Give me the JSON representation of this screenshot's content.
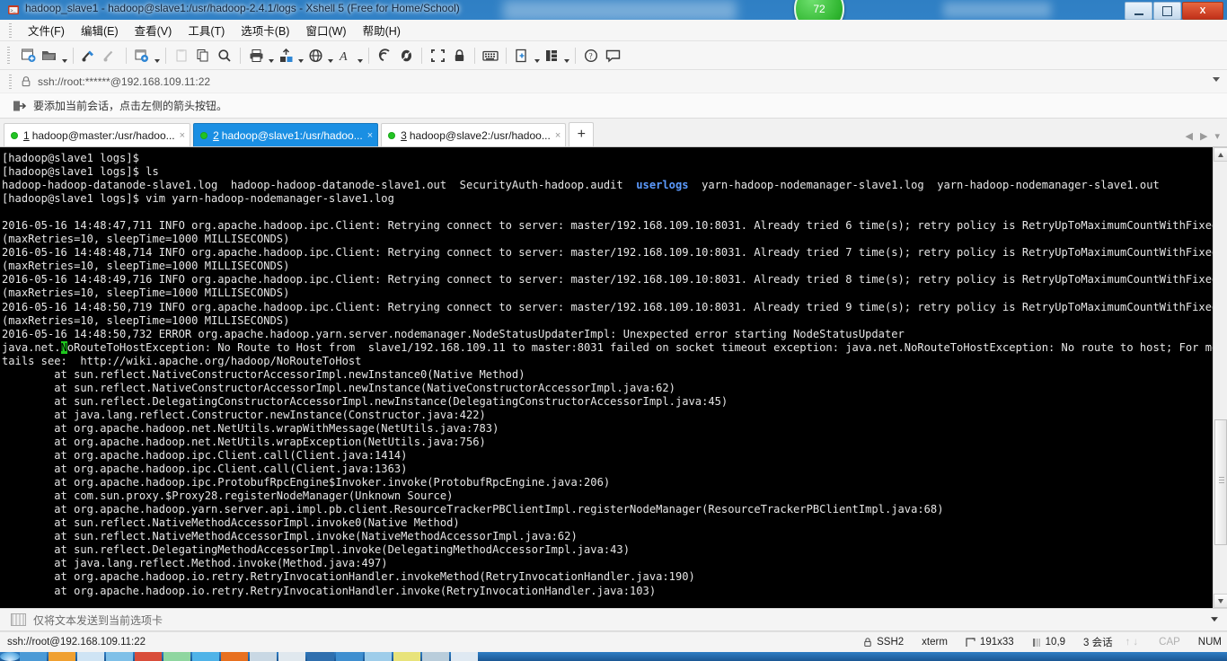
{
  "window": {
    "title": "hadoop_slave1 - hadoop@slave1:/usr/hadoop-2.4.1/logs - Xshell 5 (Free for Home/School)",
    "minimize_label": "Minimize",
    "maximize_label": "Maximize",
    "close_label": "X"
  },
  "desktop": {
    "gadget_value": "72"
  },
  "menubar": {
    "items": [
      {
        "label": "文件(F)",
        "name": "menu-file"
      },
      {
        "label": "编辑(E)",
        "name": "menu-edit"
      },
      {
        "label": "查看(V)",
        "name": "menu-view"
      },
      {
        "label": "工具(T)",
        "name": "menu-tools"
      },
      {
        "label": "选项卡(B)",
        "name": "menu-tabs"
      },
      {
        "label": "窗口(W)",
        "name": "menu-window"
      },
      {
        "label": "帮助(H)",
        "name": "menu-help"
      }
    ]
  },
  "toolbar": {
    "icons": [
      "new-session-icon",
      "open-folder-icon",
      "caret-open",
      "sep",
      "connect-icon",
      "disconnect-icon",
      "sep",
      "session-properties-icon",
      "caret-props",
      "sep",
      "paste-disabled-icon",
      "copy-icon",
      "find-icon",
      "sep",
      "print-icon",
      "caret-print",
      "transfer-icon",
      "caret-transfer",
      "browser-icon",
      "caret-browser",
      "font-icon",
      "caret-font",
      "sep",
      "ssh-tunnel-icon",
      "tunnel-pane-icon",
      "sep",
      "fullscreen-icon",
      "lock-icon",
      "sep",
      "keyboard-icon",
      "sep",
      "compose-pane-icon",
      "caret-compose",
      "layout-icon",
      "caret-layout",
      "sep",
      "help-icon",
      "feedback-icon"
    ]
  },
  "address_bar": {
    "icon": "lock-icon",
    "value": "ssh://root:******@192.168.109.11:22",
    "dropdown_icon": "chevron-down-icon"
  },
  "hint_bar": {
    "icon": "add-session-icon",
    "text": "要添加当前会话，点击左侧的箭头按钮。"
  },
  "tabs": {
    "items": [
      {
        "num": "1",
        "label": "hadoop@master:/usr/hadoo...",
        "active": false,
        "status": "connected",
        "close": "×"
      },
      {
        "num": "2",
        "label": "hadoop@slave1:/usr/hadoo...",
        "active": true,
        "status": "connected",
        "close": "×"
      },
      {
        "num": "3",
        "label": "hadoop@slave2:/usr/hadoo...",
        "active": false,
        "status": "connected",
        "close": "×"
      }
    ],
    "add_label": "+",
    "nav_prev": "◀",
    "nav_next": "▶",
    "nav_menu": "▾"
  },
  "terminal": {
    "lines": [
      {
        "segments": [
          {
            "t": "[hadoop@slave1 logs]$ "
          }
        ]
      },
      {
        "segments": [
          {
            "t": "[hadoop@slave1 logs]$ ls"
          }
        ]
      },
      {
        "segments": [
          {
            "t": "hadoop-hadoop-datanode-slave1.log  hadoop-hadoop-datanode-slave1.out  SecurityAuth-hadoop.audit  "
          },
          {
            "t": "userlogs",
            "c": "blue"
          },
          {
            "t": "  yarn-hadoop-nodemanager-slave1.log  yarn-hadoop-nodemanager-slave1.out"
          }
        ]
      },
      {
        "segments": [
          {
            "t": "[hadoop@slave1 logs]$ vim yarn-hadoop-nodemanager-slave1.log"
          }
        ]
      },
      {
        "segments": [
          {
            "t": ""
          }
        ]
      },
      {
        "segments": [
          {
            "t": "2016-05-16 14:48:47,711 INFO org.apache.hadoop.ipc.Client: Retrying connect to server: master/192.168.109.10:8031. Already tried 6 time(s); retry policy is RetryUpToMaximumCountWithFixedSleep"
          }
        ]
      },
      {
        "segments": [
          {
            "t": "(maxRetries=10, sleepTime=1000 MILLISECONDS)"
          }
        ]
      },
      {
        "segments": [
          {
            "t": "2016-05-16 14:48:48,714 INFO org.apache.hadoop.ipc.Client: Retrying connect to server: master/192.168.109.10:8031. Already tried 7 time(s); retry policy is RetryUpToMaximumCountWithFixedSleep"
          }
        ]
      },
      {
        "segments": [
          {
            "t": "(maxRetries=10, sleepTime=1000 MILLISECONDS)"
          }
        ]
      },
      {
        "segments": [
          {
            "t": "2016-05-16 14:48:49,716 INFO org.apache.hadoop.ipc.Client: Retrying connect to server: master/192.168.109.10:8031. Already tried 8 time(s); retry policy is RetryUpToMaximumCountWithFixedSleep"
          }
        ]
      },
      {
        "segments": [
          {
            "t": "(maxRetries=10, sleepTime=1000 MILLISECONDS)"
          }
        ]
      },
      {
        "segments": [
          {
            "t": "2016-05-16 14:48:50,719 INFO org.apache.hadoop.ipc.Client: Retrying connect to server: master/192.168.109.10:8031. Already tried 9 time(s); retry policy is RetryUpToMaximumCountWithFixedSleep"
          }
        ]
      },
      {
        "segments": [
          {
            "t": "(maxRetries=10, sleepTime=1000 MILLISECONDS)"
          }
        ]
      },
      {
        "segments": [
          {
            "t": "2016-05-16 14:48:50,732 ERROR org.apache.hadoop.yarn.server.nodemanager.NodeStatusUpdaterImpl: Unexpected error starting NodeStatusUpdater"
          }
        ]
      },
      {
        "segments": [
          {
            "t": "java.net."
          },
          {
            "t": "N",
            "c": "cursor"
          },
          {
            "t": "oRouteToHostException: No Route to Host from  slave1/192.168.109.11 to master:8031 failed on socket timeout exception: java.net.NoRouteToHostException: No route to host; For more de"
          }
        ]
      },
      {
        "segments": [
          {
            "t": "tails see:  http://wiki.apache.org/hadoop/NoRouteToHost"
          }
        ]
      },
      {
        "segments": [
          {
            "t": "        at sun.reflect.NativeConstructorAccessorImpl.newInstance0(Native Method)"
          }
        ]
      },
      {
        "segments": [
          {
            "t": "        at sun.reflect.NativeConstructorAccessorImpl.newInstance(NativeConstructorAccessorImpl.java:62)"
          }
        ]
      },
      {
        "segments": [
          {
            "t": "        at sun.reflect.DelegatingConstructorAccessorImpl.newInstance(DelegatingConstructorAccessorImpl.java:45)"
          }
        ]
      },
      {
        "segments": [
          {
            "t": "        at java.lang.reflect.Constructor.newInstance(Constructor.java:422)"
          }
        ]
      },
      {
        "segments": [
          {
            "t": "        at org.apache.hadoop.net.NetUtils.wrapWithMessage(NetUtils.java:783)"
          }
        ]
      },
      {
        "segments": [
          {
            "t": "        at org.apache.hadoop.net.NetUtils.wrapException(NetUtils.java:756)"
          }
        ]
      },
      {
        "segments": [
          {
            "t": "        at org.apache.hadoop.ipc.Client.call(Client.java:1414)"
          }
        ]
      },
      {
        "segments": [
          {
            "t": "        at org.apache.hadoop.ipc.Client.call(Client.java:1363)"
          }
        ]
      },
      {
        "segments": [
          {
            "t": "        at org.apache.hadoop.ipc.ProtobufRpcEngine$Invoker.invoke(ProtobufRpcEngine.java:206)"
          }
        ]
      },
      {
        "segments": [
          {
            "t": "        at com.sun.proxy.$Proxy28.registerNodeManager(Unknown Source)"
          }
        ]
      },
      {
        "segments": [
          {
            "t": "        at org.apache.hadoop.yarn.server.api.impl.pb.client.ResourceTrackerPBClientImpl.registerNodeManager(ResourceTrackerPBClientImpl.java:68)"
          }
        ]
      },
      {
        "segments": [
          {
            "t": "        at sun.reflect.NativeMethodAccessorImpl.invoke0(Native Method)"
          }
        ]
      },
      {
        "segments": [
          {
            "t": "        at sun.reflect.NativeMethodAccessorImpl.invoke(NativeMethodAccessorImpl.java:62)"
          }
        ]
      },
      {
        "segments": [
          {
            "t": "        at sun.reflect.DelegatingMethodAccessorImpl.invoke(DelegatingMethodAccessorImpl.java:43)"
          }
        ]
      },
      {
        "segments": [
          {
            "t": "        at java.lang.reflect.Method.invoke(Method.java:497)"
          }
        ]
      },
      {
        "segments": [
          {
            "t": "        at org.apache.hadoop.io.retry.RetryInvocationHandler.invokeMethod(RetryInvocationHandler.java:190)"
          }
        ]
      },
      {
        "segments": [
          {
            "t": "        at org.apache.hadoop.io.retry.RetryInvocationHandler.invoke(RetryInvocationHandler.java:103)"
          }
        ]
      }
    ]
  },
  "send_bar": {
    "icon": "keyboard-icon",
    "text": "仅将文本发送到当前选项卡",
    "dropdown_icon": "chevron-down-icon"
  },
  "status_bar": {
    "connection": "ssh://root@192.168.109.11:22",
    "protocol_icon": "lock-icon",
    "protocol": "SSH2",
    "terminal_type": "xterm",
    "size_icon": "resize-icon",
    "size": "191x33",
    "cursor_icon": "cursor-icon",
    "cursor_pos": "10,9",
    "sessions": "3 会话",
    "transfer_up": "↑",
    "transfer_down": "↓",
    "caps": "CAP",
    "num": "NUM"
  }
}
